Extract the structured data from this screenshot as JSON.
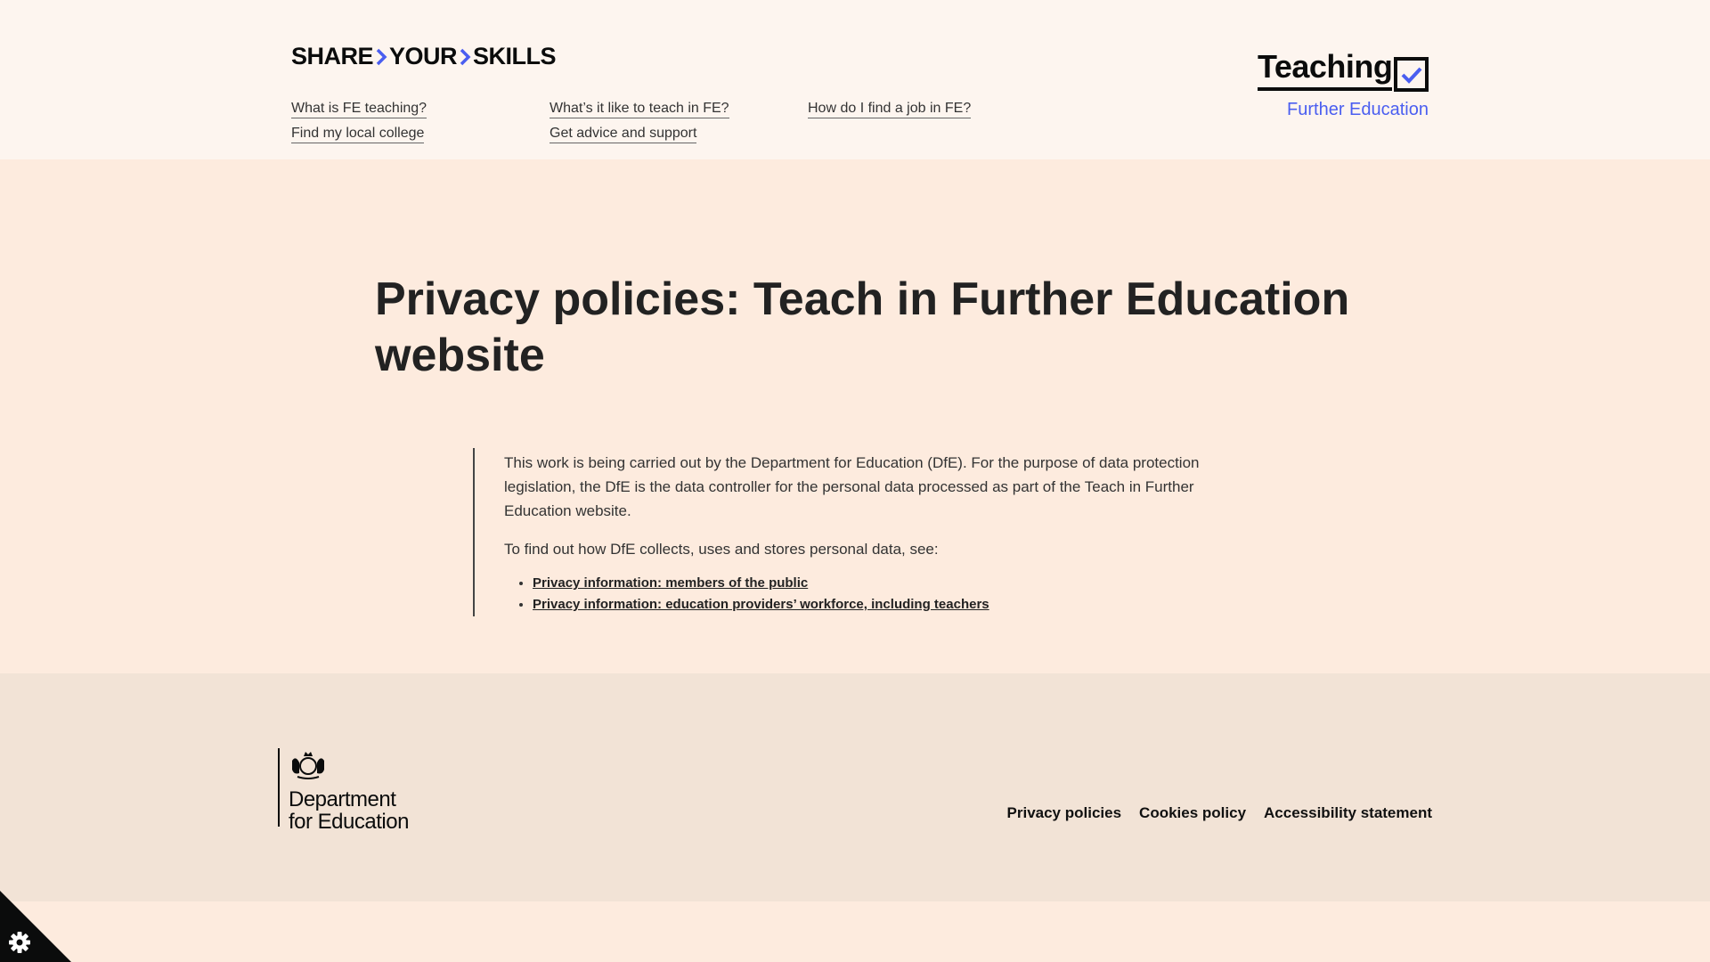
{
  "header": {
    "brand": {
      "part1": "SHARE",
      "part2": "YOUR",
      "part3": "SKILLS"
    },
    "nav": {
      "col1": [
        "What is FE teaching?",
        "Find my local college"
      ],
      "col2": [
        "What’s it like to teach in FE?",
        "Get advice and support"
      ],
      "col3": [
        "How do I find a job in FE?"
      ]
    },
    "teaching_logo": {
      "word": "Teaching",
      "subtitle": "Further Education"
    }
  },
  "main": {
    "title": "Privacy policies: Teach in Further Education website",
    "paragraph1": "This work is being carried out by the Department for Education (DfE). For the purpose of data protection legislation, the DfE is the data controller for the personal data processed as part of the Teach in Further Education website.",
    "paragraph2": "To find out how DfE collects, uses and stores personal data, see:",
    "links": [
      "Privacy information: members of the public",
      "Privacy information: education providers’ workforce, including teachers"
    ]
  },
  "footer": {
    "dfe_line1": "Department",
    "dfe_line2": "for Education",
    "links": [
      "Privacy policies",
      "Cookies policy",
      "Accessibility statement"
    ]
  },
  "colors": {
    "accent": "#4a5ef0",
    "header_bg": "#fdf5ef",
    "page_bg": "#fdebde",
    "footer_bg": "#f2e3d6"
  },
  "icons": {
    "cookie_settings": "gear-icon",
    "logo_check": "check-icon"
  }
}
